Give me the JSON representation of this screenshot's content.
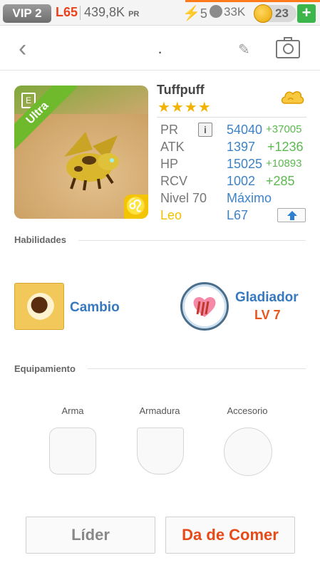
{
  "status": {
    "vip": "VIP 2",
    "level": "L65",
    "power": "439,8K",
    "power_unit": "PR",
    "energy": "5",
    "paws": "33K",
    "coins": "23",
    "add": "+"
  },
  "nav": {
    "back_glyph": "‹",
    "title": ".",
    "edit_glyph": "✎",
    "camera": "camera-icon"
  },
  "pet": {
    "badge": "Ultra",
    "card_icon": "E",
    "zodiac_glyph": "♌",
    "name": "Tuffpuff",
    "stars": "★★★★",
    "stars_count": 4,
    "element_icon": "cloud-icon",
    "stats": {
      "pr_label": "PR",
      "pr_value": "54040",
      "pr_bonus": "+37005",
      "atk_label": "ATK",
      "atk_value": "1397",
      "atk_bonus": "+1236",
      "hp_label": "HP",
      "hp_value": "15025",
      "hp_bonus": "+10893",
      "rcv_label": "RCV",
      "rcv_value": "1002",
      "rcv_bonus": "+285",
      "level_label": "Nivel 70",
      "level_value": "Máximo",
      "sign_label": "Leo",
      "sign_value": "L67"
    },
    "info_glyph": "i"
  },
  "skills": {
    "header": "Habilidades",
    "skill1": "Cambio",
    "skill2": "Gladiador",
    "skill2_level": "LV 7"
  },
  "equipment": {
    "header": "Equipamiento",
    "weapon": "Arma",
    "armor": "Armadura",
    "accessory": "Accesorio"
  },
  "buttons": {
    "leader": "Líder",
    "feed": "Da de Comer"
  },
  "colors": {
    "accent_blue": "#3d83c7",
    "bonus_green": "#5bb94f",
    "feed_orange": "#e64a19",
    "level_red": "#e8431c",
    "ultra_green": "#6fba2c"
  }
}
